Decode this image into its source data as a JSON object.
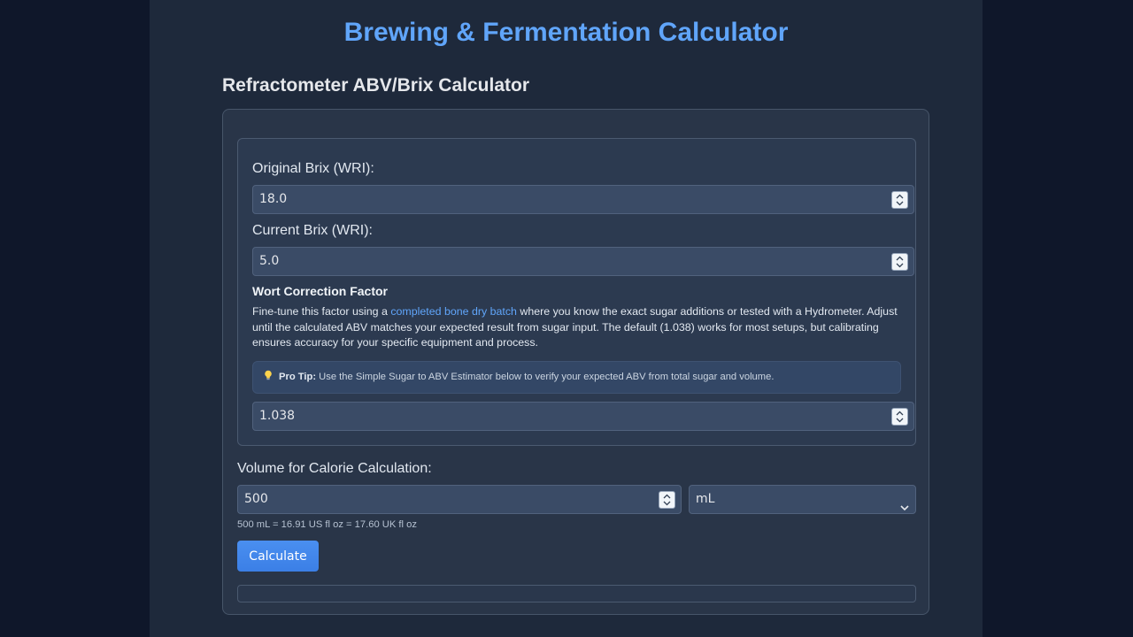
{
  "app": {
    "title": "Brewing & Fermentation Calculator"
  },
  "section": {
    "title": "Refractometer ABV/Brix Calculator"
  },
  "original_brix": {
    "label": "Original Brix (WRI):",
    "value": "18.0"
  },
  "current_brix": {
    "label": "Current Brix (WRI):",
    "value": "5.0"
  },
  "wort_correction": {
    "title": "Wort Correction Factor",
    "desc_before": "Fine-tune this factor using a ",
    "desc_link": "completed bone dry batch",
    "desc_after": " where you know the exact sugar additions or tested with a Hydrometer. Adjust until the calculated ABV matches your expected result from sugar input. The default (1.038) works for most setups, but calibrating ensures accuracy for your specific equipment and process.",
    "tip_label": "Pro Tip:",
    "tip_text": " Use the Simple Sugar to ABV Estimator below to verify your expected ABV from total sugar and volume.",
    "value": "1.038"
  },
  "volume": {
    "label": "Volume for Calorie Calculation:",
    "value": "500",
    "unit": "mL",
    "conversion": "500 mL = 16.91 US fl oz = 17.60 UK fl oz"
  },
  "calculate_label": "Calculate",
  "colors": {
    "accent": "#60a5fa",
    "button": "#3b82f6",
    "background": "#0f172a",
    "panel": "#1e293b"
  },
  "icons": {
    "tip": "lightbulb-icon",
    "spinner": "spin-updown-icon",
    "select": "chevron-down-icon"
  }
}
